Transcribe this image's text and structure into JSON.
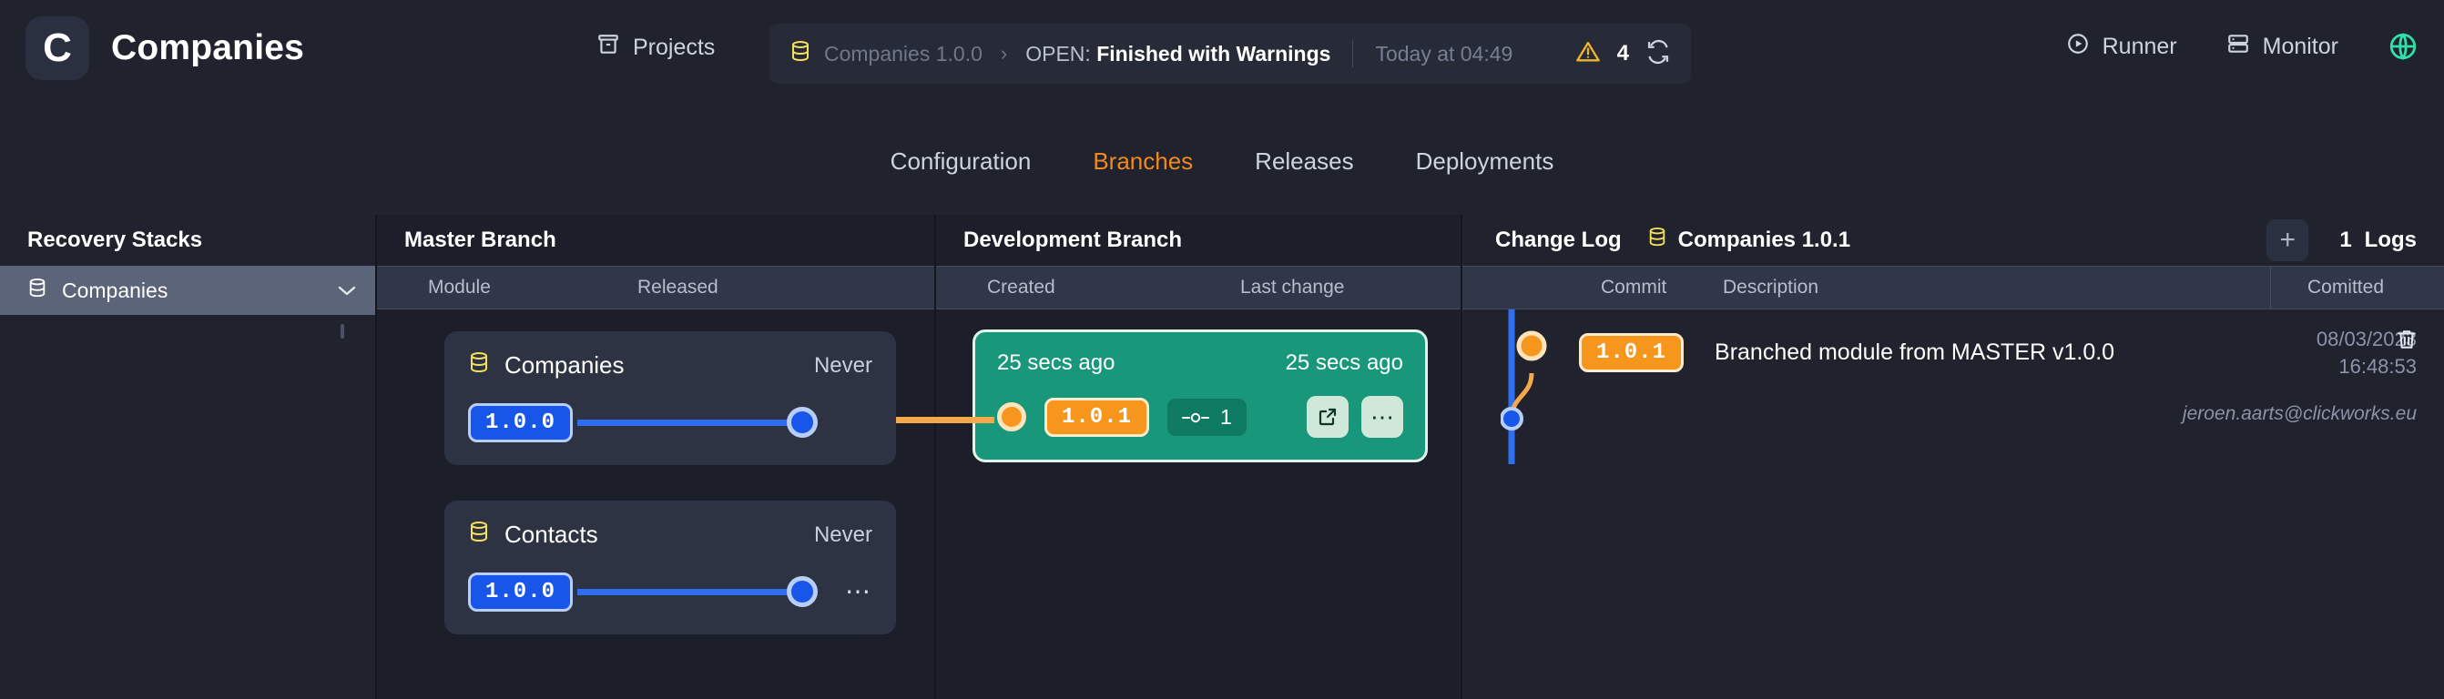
{
  "header": {
    "logo_letter": "C",
    "title": "Companies",
    "projects_label": "Projects",
    "projects_icon": "projects-icon",
    "status": {
      "db_icon": "database-icon",
      "crumb": "Companies 1.0.0",
      "chevron": "›",
      "state_prefix": "OPEN:",
      "state_value": "Finished with Warnings",
      "timestamp": "Today at 04:49",
      "warning_icon": "warning-triangle-icon",
      "warning_count": "4",
      "refresh_icon": "refresh-icon"
    },
    "actions": [
      {
        "label": "Runner",
        "icon": "play-circle-icon"
      },
      {
        "label": "Monitor",
        "icon": "server-icon"
      }
    ],
    "globe_icon": "globe-icon",
    "globe_color": "#2fe0a8"
  },
  "tabs": [
    {
      "label": "Configuration",
      "active": false
    },
    {
      "label": "Branches",
      "active": true
    },
    {
      "label": "Releases",
      "active": false
    },
    {
      "label": "Deployments",
      "active": false
    }
  ],
  "sidebar": {
    "title": "Recovery Stacks",
    "items": [
      {
        "label": "Companies",
        "icon": "database-icon",
        "chevron": "⌄",
        "selected": true
      }
    ]
  },
  "master_panel": {
    "title": "Master Branch",
    "columns": [
      "Module",
      "Released"
    ],
    "modules": [
      {
        "name": "Companies",
        "icon": "database-icon",
        "released": "Never",
        "version": "1.0.0",
        "has_menu": false
      },
      {
        "name": "Contacts",
        "icon": "database-icon",
        "released": "Never",
        "version": "1.0.0",
        "has_menu": true,
        "menu_icon": "ellipsis-icon"
      }
    ]
  },
  "dev_panel": {
    "title": "Development Branch",
    "columns": [
      "Created",
      "Last change"
    ],
    "branch": {
      "created": "25 secs ago",
      "last_change": "25 secs ago",
      "version": "1.0.1",
      "commit_count": "1",
      "commit_icon": "commit-icon",
      "open_icon": "external-link-icon",
      "menu_icon": "ellipsis-icon"
    }
  },
  "changelog_panel": {
    "title": "Change Log",
    "module_icon": "database-icon",
    "module_label": "Companies 1.0.1",
    "add_icon": "plus-icon",
    "logs_count": "1",
    "logs_label": "Logs",
    "columns": [
      "Commit",
      "Description",
      "Comitted"
    ],
    "rows": [
      {
        "version": "1.0.1",
        "description": "Branched module from MASTER v1.0.0",
        "date": "08/03/2023",
        "time": "16:48:53",
        "author": "jeroen.aarts@clickworks.eu",
        "delete_icon": "trash-icon"
      }
    ]
  },
  "colors": {
    "accent_orange": "#f08a1e",
    "version_blue": "#1756e8",
    "branch_green": "#19977b",
    "globe_green": "#2fe0a8",
    "db_yellow": "#f5e05a"
  }
}
